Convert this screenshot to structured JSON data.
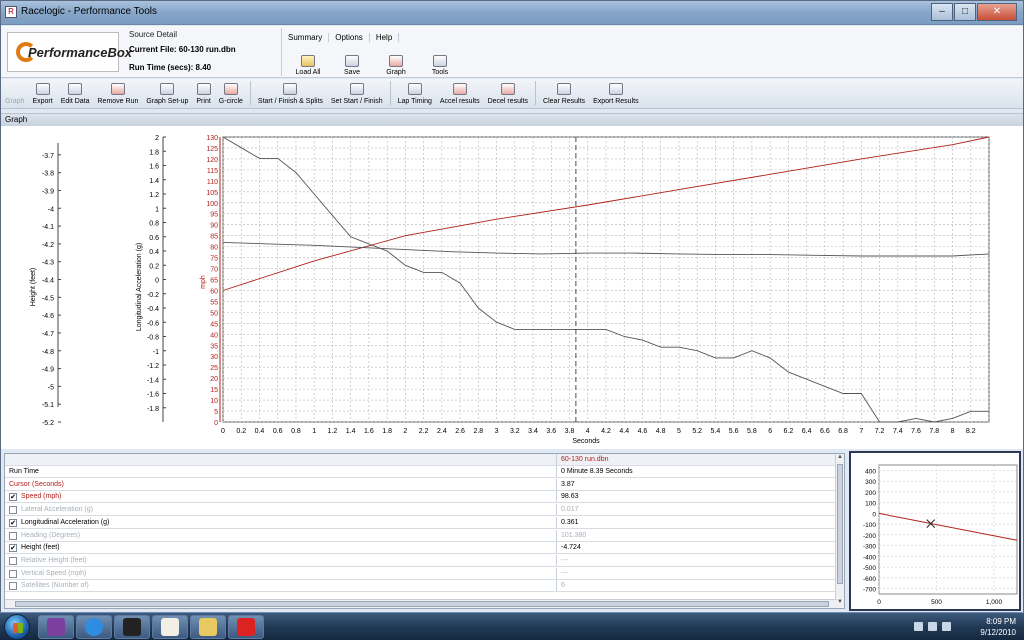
{
  "window": {
    "title": "Racelogic - Performance Tools",
    "controls": [
      "minimize",
      "maximize",
      "close"
    ]
  },
  "header": {
    "logo_text": "PerformanceBox",
    "source_detail_label": "Source Detail",
    "current_file": "Current File: 60-130 run.dbn",
    "run_time": "Run Time (secs): 8.40",
    "menu": [
      "Summary",
      "Options",
      "Help"
    ],
    "quick_buttons": [
      "Load All",
      "Save",
      "Graph",
      "Tools"
    ]
  },
  "toolbar": {
    "items": [
      {
        "label": "Graph",
        "disabled": true
      },
      {
        "label": "Export"
      },
      {
        "label": "Edit Data"
      },
      {
        "label": "Remove Run"
      },
      {
        "label": "Graph Set-up"
      },
      {
        "label": "Print"
      },
      {
        "label": "G-circle"
      },
      {
        "label": "Start / Finish & Splits"
      },
      {
        "label": "Set Start / Finish"
      },
      {
        "label": "Lap Timing"
      },
      {
        "label": "Accel results"
      },
      {
        "label": "Decel results"
      },
      {
        "label": "Clear Results"
      },
      {
        "label": "Export Results"
      }
    ]
  },
  "graph_panel": {
    "tab_label": "Graph",
    "x_axis_label": "Seconds",
    "height_axis_label": "Height (feet)",
    "accel_axis_label": "Longitudinal Acceleration (g)",
    "speed_axis_label": "mph",
    "cursor_seconds": 3.87
  },
  "chart_data": [
    {
      "type": "line",
      "xlabel": "Seconds",
      "xlim": [
        0,
        8.4
      ],
      "x_ticks": [
        "0",
        "0.2",
        "0.4",
        "0.6",
        "0.8",
        "1",
        "1.2",
        "1.4",
        "1.6",
        "1.8",
        "2",
        "2.2",
        "2.4",
        "2.6",
        "2.8",
        "3",
        "3.2",
        "3.4",
        "3.6",
        "3.8",
        "4",
        "4.2",
        "4.4",
        "4.6",
        "4.8",
        "5",
        "5.2",
        "5.4",
        "5.6",
        "5.8",
        "6",
        "6.2",
        "6.4",
        "6.6",
        "6.8",
        "7",
        "7.2",
        "7.4",
        "7.6",
        "7.8",
        "8",
        "8.2"
      ],
      "axes": {
        "height": {
          "label": "Height (feet)",
          "ylim": [
            -5.2,
            -3.6
          ],
          "ticks": [
            "-3.7",
            "-3.8",
            "-3.9",
            "-4",
            "-4.1",
            "-4.2",
            "-4.3",
            "-4.4",
            "-4.5",
            "-4.6",
            "-4.7",
            "-4.8",
            "-4.9",
            "-5",
            "-5.1",
            "-5.2"
          ]
        },
        "accel": {
          "label": "Longitudinal Acceleration (g)",
          "ylim": [
            -2,
            2
          ],
          "ticks": [
            "2",
            "1.8",
            "1.6",
            "1.4",
            "1.2",
            "1",
            "0.8",
            "0.6",
            "0.4",
            "0.2",
            "0",
            "-0.2",
            "-0.4",
            "-0.6",
            "-0.8",
            "-1",
            "-1.2",
            "-1.4",
            "-1.6",
            "-1.8"
          ]
        },
        "speed": {
          "label": "mph",
          "ylim": [
            0,
            130
          ],
          "ticks": [
            "130",
            "125",
            "120",
            "115",
            "110",
            "105",
            "100",
            "95",
            "90",
            "85",
            "80",
            "75",
            "70",
            "65",
            "60",
            "55",
            "50",
            "45",
            "40",
            "35",
            "30",
            "25",
            "20",
            "15",
            "10",
            "5",
            "0"
          ]
        }
      },
      "series": [
        {
          "name": "Speed (mph)",
          "axis": "speed",
          "color": "#b0201a",
          "x": [
            0,
            1,
            2,
            3,
            4,
            5,
            6,
            7,
            8,
            8.4
          ],
          "y": [
            60,
            73.5,
            85,
            92.5,
            99,
            106,
            113,
            120,
            126.5,
            130
          ]
        },
        {
          "name": "Longitudinal Acceleration (g)",
          "axis": "accel",
          "color": "#555555",
          "x": [
            0,
            0.5,
            1,
            1.5,
            2,
            2.5,
            3,
            3.5,
            4,
            4.5,
            5,
            5.5,
            6,
            6.5,
            7,
            7.5,
            8,
            8.4
          ],
          "y": [
            0.52,
            0.5,
            0.48,
            0.45,
            0.42,
            0.39,
            0.37,
            0.36,
            0.37,
            0.37,
            0.36,
            0.35,
            0.35,
            0.34,
            0.33,
            0.33,
            0.33,
            0.36
          ]
        },
        {
          "name": "Height (feet)",
          "axis": "height",
          "color": "#555555",
          "x": [
            0,
            0.2,
            0.4,
            0.6,
            0.8,
            1.0,
            1.2,
            1.4,
            1.6,
            1.8,
            2.0,
            2.2,
            2.4,
            2.6,
            2.8,
            3.0,
            3.2,
            3.4,
            3.6,
            3.8,
            4.0,
            4.2,
            4.4,
            4.6,
            4.8,
            5.0,
            5.2,
            5.4,
            5.6,
            5.8,
            6.0,
            6.2,
            6.4,
            6.6,
            6.8,
            7.0,
            7.2,
            7.4,
            7.6,
            7.8,
            8.0,
            8.2,
            8.4
          ],
          "y": [
            -3.6,
            -3.66,
            -3.72,
            -3.72,
            -3.8,
            -3.92,
            -4.04,
            -4.16,
            -4.2,
            -4.24,
            -4.32,
            -4.36,
            -4.36,
            -4.42,
            -4.56,
            -4.64,
            -4.68,
            -4.68,
            -4.68,
            -4.68,
            -4.68,
            -4.68,
            -4.72,
            -4.74,
            -4.78,
            -4.78,
            -4.8,
            -4.84,
            -4.84,
            -4.8,
            -4.84,
            -4.92,
            -4.96,
            -5.0,
            -5.04,
            -5.04,
            -5.2,
            -5.22,
            -5.18,
            -5.22,
            -5.18,
            -5.14,
            -5.14
          ]
        }
      ],
      "cursor_x": 3.87
    },
    {
      "type": "scatter",
      "x_ticks": [
        "0",
        "500",
        "1,000"
      ],
      "y_ticks": [
        "400",
        "300",
        "200",
        "100",
        "0",
        "-100",
        "-200",
        "-300",
        "-400",
        "-500",
        "-600",
        "-700"
      ],
      "xlim": [
        0,
        1200
      ],
      "ylim": [
        -750,
        450
      ],
      "line": {
        "x": [
          0,
          1200
        ],
        "y": [
          0,
          -250
        ],
        "color": "#b0201a"
      },
      "marker": {
        "x": 450,
        "y": -95
      }
    }
  ],
  "table": {
    "file_header": "60-130 run.dbn",
    "rows": [
      {
        "label": "Run Time",
        "value": "0 Minute 8.39 Seconds",
        "check": "none",
        "style": "plain"
      },
      {
        "label": "Cursor (Seconds)",
        "value": "3.87",
        "check": "none",
        "style": "red"
      },
      {
        "label": "Speed (mph)",
        "value": "98.63",
        "check": "on",
        "style": "red"
      },
      {
        "label": "Lateral Acceleration (g)",
        "value": "0.017",
        "check": "off",
        "style": "dim"
      },
      {
        "label": "Longitudinal Acceleration (g)",
        "value": "0.361",
        "check": "on",
        "style": "normal"
      },
      {
        "label": "Heading (Degrees)",
        "value": "101.380",
        "check": "off",
        "style": "dim"
      },
      {
        "label": "Height (feet)",
        "value": "-4.724",
        "check": "on",
        "style": "normal"
      },
      {
        "label": "Relative Height (feet)",
        "value": "---",
        "check": "off",
        "style": "dim"
      },
      {
        "label": "Vertical Speed (mph)",
        "value": "---",
        "check": "off",
        "style": "dim"
      },
      {
        "label": "Satellites (Number of)",
        "value": "6",
        "check": "off",
        "style": "dim"
      }
    ]
  },
  "taskbar": {
    "time": "8:09 PM",
    "date": "9/12/2010",
    "apps": [
      "start",
      "yahoo-messenger",
      "internet-explorer",
      "z-app",
      "performancebox",
      "mail",
      "quicken"
    ]
  },
  "colors": {
    "speed": "#b0201a",
    "grid": "#aaaaaa",
    "accent": "#2b3a52"
  }
}
